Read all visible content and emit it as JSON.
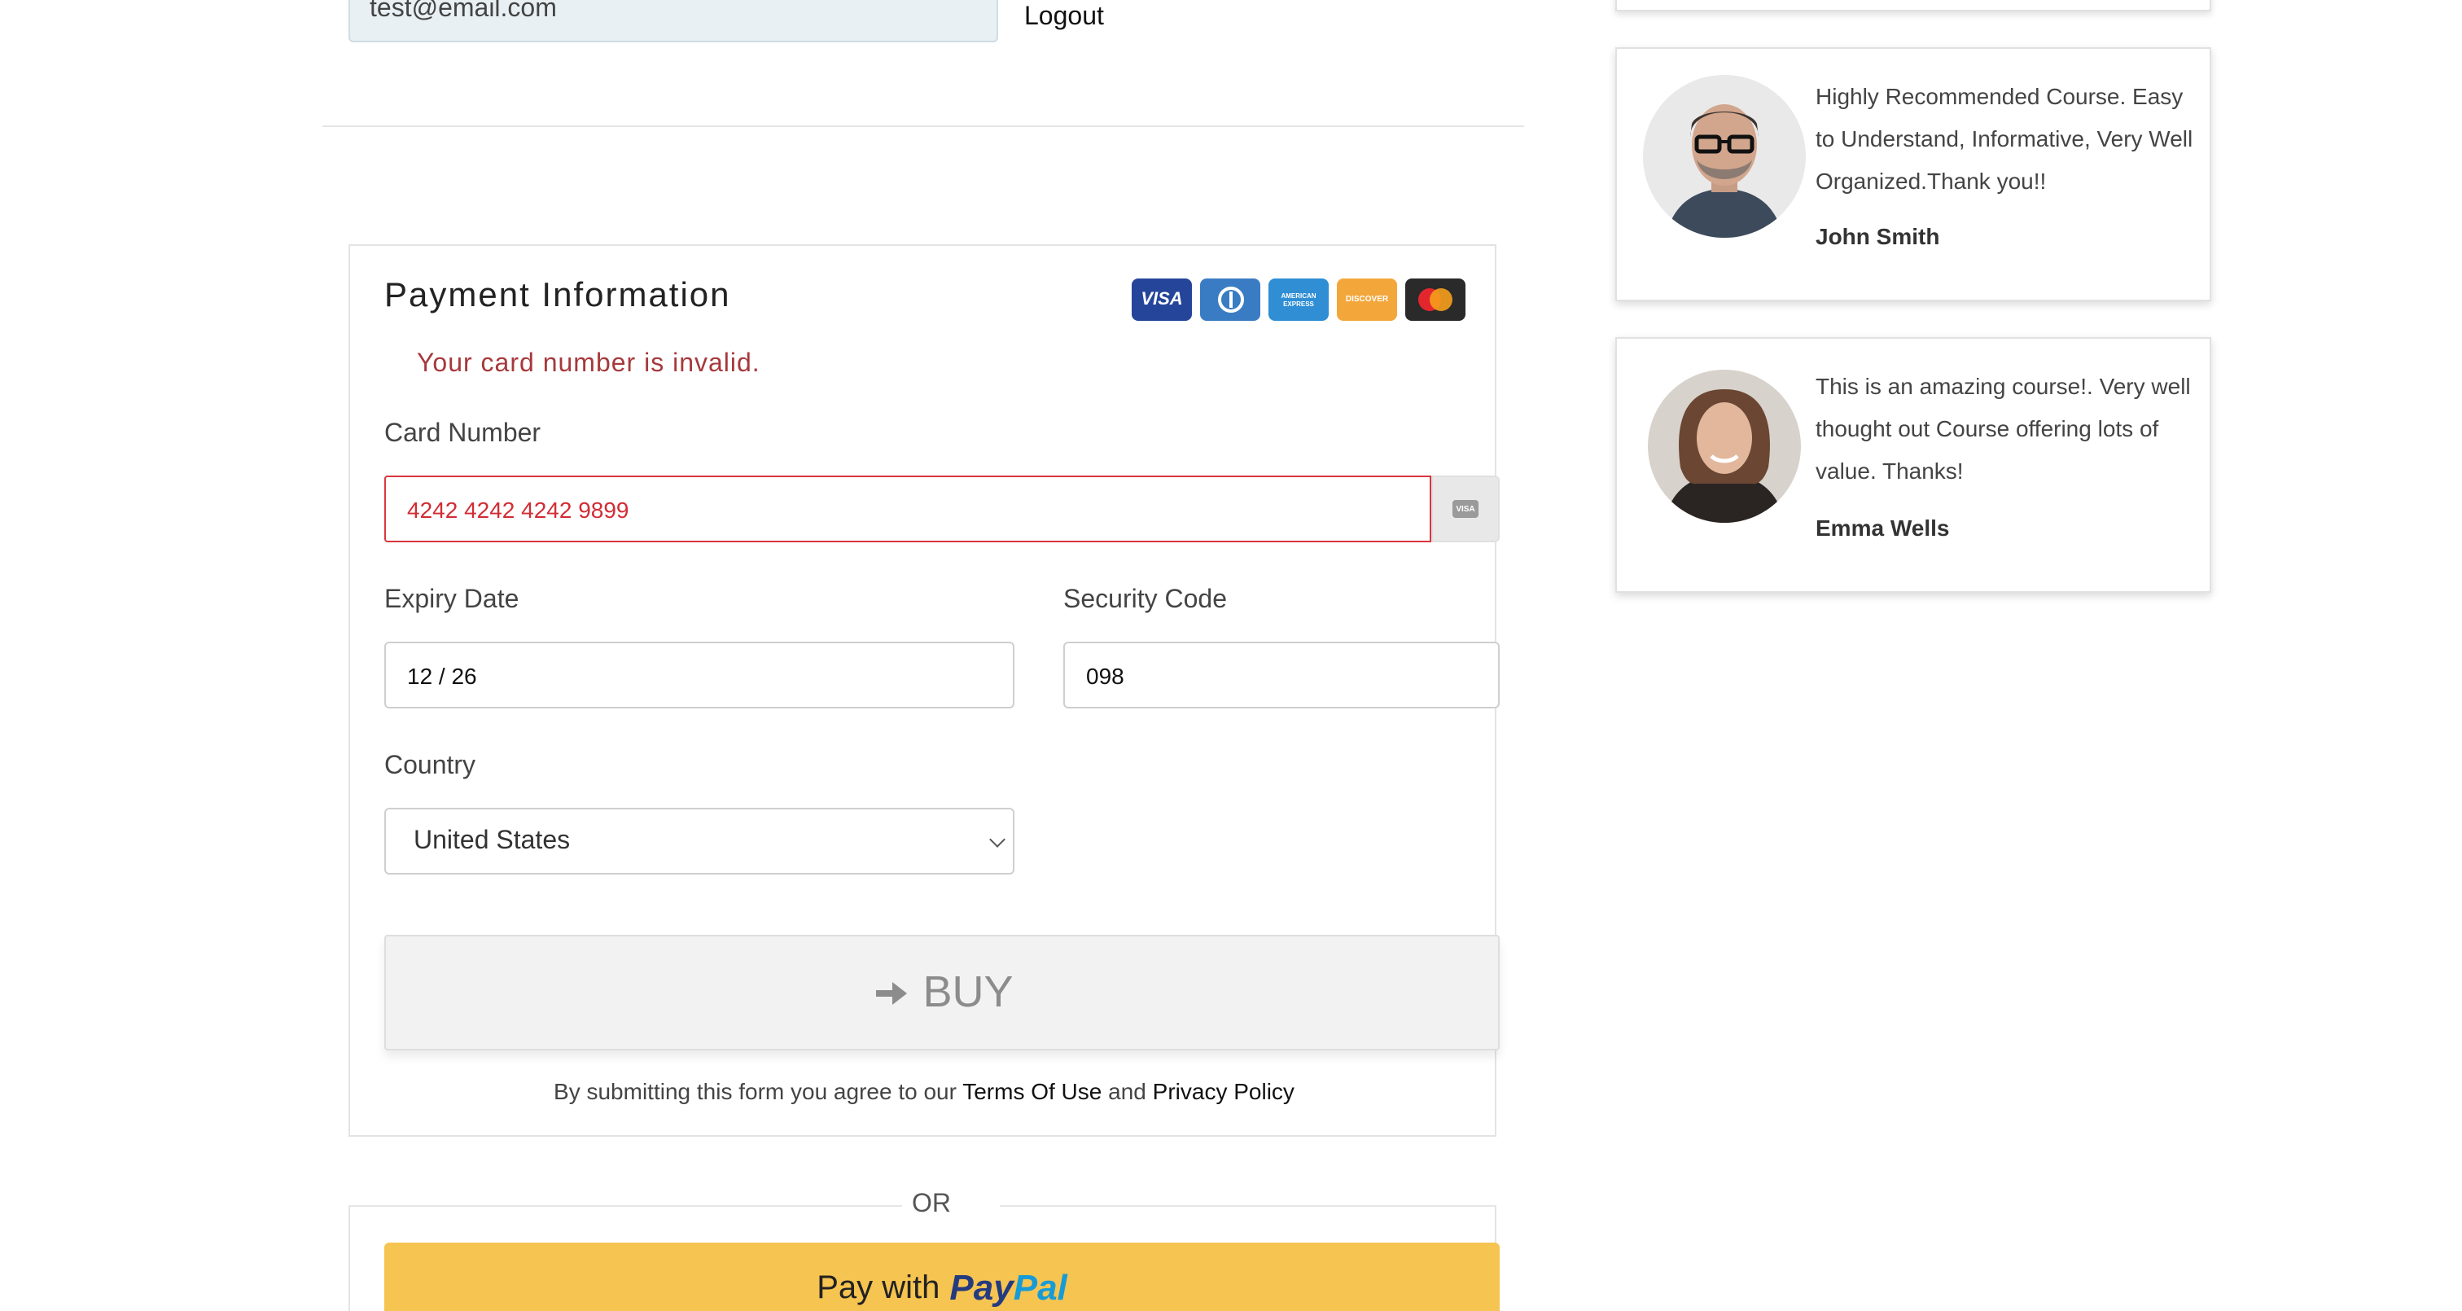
{
  "account": {
    "email_value": "test@email.com",
    "logout_label": "Logout"
  },
  "payment": {
    "title": "Payment Information",
    "error": "Your card number is invalid.",
    "card_logos": [
      {
        "name": "visa",
        "label": "VISA",
        "color": "#25459a"
      },
      {
        "name": "diners",
        "label": "",
        "color": "#3a7cc3"
      },
      {
        "name": "amex",
        "label": "AMERICAN EXPRESS",
        "color": "#2f8ed4"
      },
      {
        "name": "discover",
        "label": "DISCOVER",
        "color": "#f3a73b"
      },
      {
        "name": "mastercard",
        "label": "",
        "color": "#2a2a2a"
      }
    ],
    "card_number_label": "Card Number",
    "card_number_value": "4242 4242 4242 9899",
    "card_addon_icon": "VISA",
    "expiry_label": "Expiry Date",
    "expiry_value": "12 / 26",
    "cvc_label": "Security Code",
    "cvc_value": "098",
    "country_label": "Country",
    "country_value": "United States",
    "buy_label": "BUY",
    "terms_prefix": "By submitting this form you agree to our ",
    "terms_link": "Terms Of Use",
    "terms_and": " and ",
    "privacy_link": "Privacy Policy",
    "error_color": "#d12d35"
  },
  "alt_payment": {
    "or_label": "OR",
    "paypal_prefix": "Pay with",
    "paypal_logo_pay": "Pay",
    "paypal_logo_pal": "Pal",
    "button_color": "#f6c450"
  },
  "testimonials": [
    {
      "quote": "Highly Recommended Course. Easy to Understand, Informative, Very Well Organized.Thank you!!",
      "author": "John Smith"
    },
    {
      "quote": "This is an amazing course!. Very well thought out Course offering lots of value. Thanks!",
      "author": "Emma Wells"
    }
  ]
}
